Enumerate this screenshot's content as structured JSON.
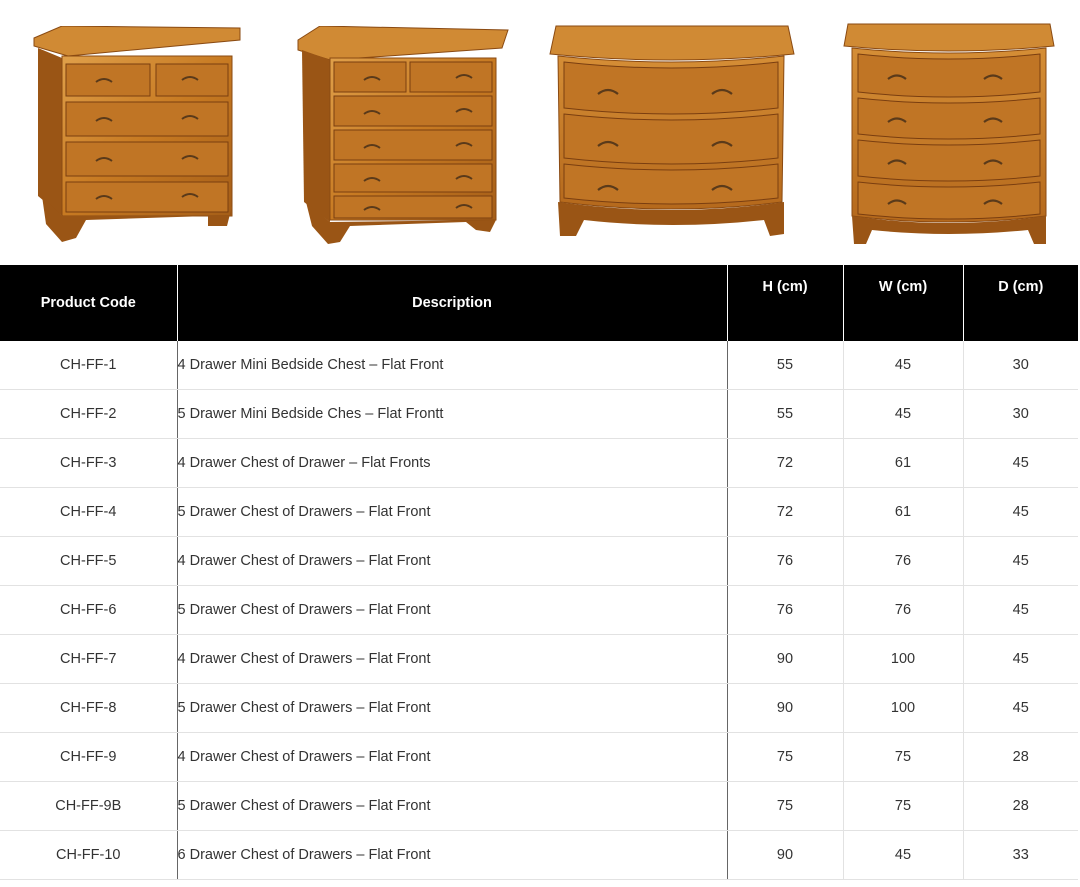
{
  "gallery": {
    "images": [
      {
        "name": "4-drawer-mini-chest-image",
        "icon": "chest-of-drawers-icon"
      },
      {
        "name": "5-drawer-mini-chest-image",
        "icon": "chest-of-drawers-icon"
      },
      {
        "name": "bow-front-3-drawer-chest-image",
        "icon": "chest-of-drawers-icon"
      },
      {
        "name": "bow-front-4-drawer-chest-image",
        "icon": "chest-of-drawers-icon"
      }
    ],
    "colors": {
      "wood": "#c77a22",
      "wood_dark": "#8a4a12",
      "wood_light": "#e0a04a",
      "handle": "#5a3a1a"
    }
  },
  "table": {
    "headers": {
      "code": "Product Code",
      "description": "Description",
      "h": "H (cm)",
      "w": "W (cm)",
      "d": "D (cm)"
    },
    "rows": [
      {
        "code": "CH-FF-1",
        "description": "4 Drawer Mini Bedside Chest – Flat Front",
        "h": "55",
        "w": "45",
        "d": "30"
      },
      {
        "code": "CH-FF-2",
        "description": "5 Drawer Mini Bedside Ches – Flat Frontt",
        "h": "55",
        "w": "45",
        "d": "30"
      },
      {
        "code": "CH-FF-3",
        "description": "4 Drawer Chest of Drawer – Flat Fronts",
        "h": "72",
        "w": "61",
        "d": "45"
      },
      {
        "code": "CH-FF-4",
        "description": "5 Drawer Chest of Drawers – Flat Front",
        "h": "72",
        "w": "61",
        "d": "45"
      },
      {
        "code": "CH-FF-5",
        "description": "4 Drawer Chest of Drawers – Flat Front",
        "h": "76",
        "w": "76",
        "d": "45"
      },
      {
        "code": "CH-FF-6",
        "description": "5 Drawer Chest of Drawers – Flat Front",
        "h": "76",
        "w": "76",
        "d": "45"
      },
      {
        "code": "CH-FF-7",
        "description": "4 Drawer Chest of Drawers – Flat Front",
        "h": "90",
        "w": "100",
        "d": "45"
      },
      {
        "code": "CH-FF-8",
        "description": "5 Drawer Chest of Drawers – Flat Front",
        "h": "90",
        "w": "100",
        "d": "45"
      },
      {
        "code": "CH-FF-9",
        "description": "4 Drawer Chest of Drawers – Flat Front",
        "h": "75",
        "w": "75",
        "d": "28"
      },
      {
        "code": "CH-FF-9B",
        "description": "5 Drawer Chest of Drawers – Flat Front",
        "h": "75",
        "w": "75",
        "d": "28"
      },
      {
        "code": "CH-FF-10",
        "description": "6 Drawer Chest of Drawers – Flat Front",
        "h": "90",
        "w": "45",
        "d": "33"
      }
    ]
  }
}
